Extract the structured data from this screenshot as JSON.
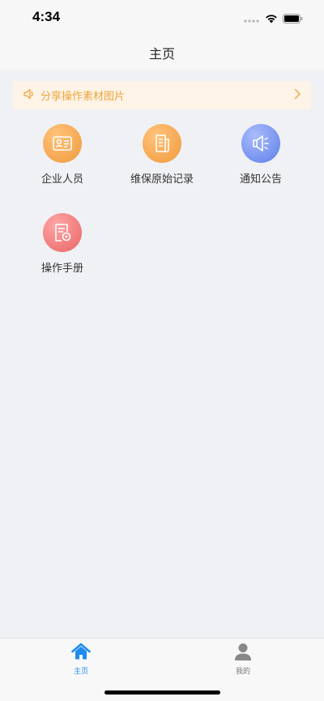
{
  "status_bar": {
    "time": "4:34"
  },
  "nav": {
    "title": "主页"
  },
  "notice": {
    "text": "分享操作素材图片"
  },
  "grid": [
    {
      "label": "企业人员",
      "icon": "id-card-icon"
    },
    {
      "label": "维保原始记录",
      "icon": "document-icon"
    },
    {
      "label": "通知公告",
      "icon": "megaphone-icon"
    },
    {
      "label": "操作手册",
      "icon": "manual-icon"
    }
  ],
  "tabbar": [
    {
      "label": "主页",
      "icon": "home-icon",
      "active": true
    },
    {
      "label": "我的",
      "icon": "person-icon",
      "active": false
    }
  ],
  "colors": {
    "accent": "#1e8cf0",
    "notice_text": "#f0a43c",
    "notice_bg": "#fdf3e6",
    "orange_icon": "#f5a44a",
    "blue_icon": "#6b8cf0",
    "red_icon": "#ee7373"
  }
}
